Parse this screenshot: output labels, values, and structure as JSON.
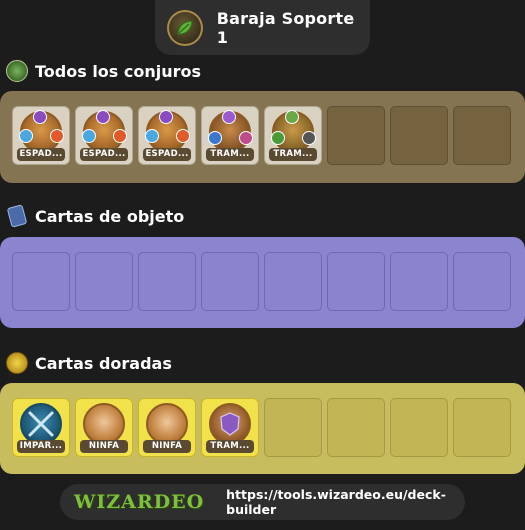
{
  "deck": {
    "title": "Baraja Soporte 1",
    "icon": "leaf-deck-icon"
  },
  "sections": {
    "spells": {
      "title": "Todos los conjuros",
      "icon": "spells-icon",
      "panel_color": "#857452",
      "cards": [
        {
          "name": "ESPAD..."
        },
        {
          "name": "ESPAD..."
        },
        {
          "name": "ESPAD..."
        },
        {
          "name": "TRAM..."
        },
        {
          "name": "TRAM..."
        }
      ],
      "total_slots": 8
    },
    "items": {
      "title": "Cartas de objeto",
      "icon": "item-card-icon",
      "panel_color": "#8b85cf",
      "cards": [],
      "total_slots": 8
    },
    "gold": {
      "title": "Cartas doradas",
      "icon": "gold-coin-icon",
      "panel_color": "#c8bd5e",
      "cards": [
        {
          "name": "IMPAR..."
        },
        {
          "name": "NINFA"
        },
        {
          "name": "NINFA"
        },
        {
          "name": "TRAM..."
        }
      ],
      "total_slots": 8
    }
  },
  "footer": {
    "logo": "WIZARDEO",
    "url": "https://tools.wizardeo.eu/deck-builder"
  }
}
